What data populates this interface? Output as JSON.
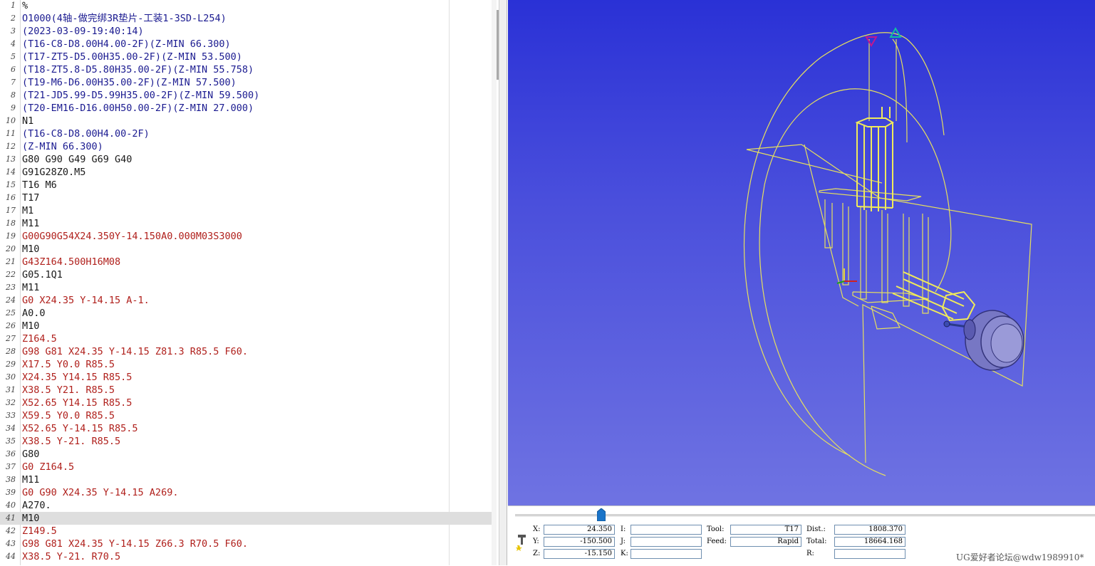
{
  "editor": {
    "lines": [
      {
        "n": "1",
        "text": "%",
        "color": "black"
      },
      {
        "n": "2",
        "text": "O1000(4轴-做完绑3R垫片-工装1-3SD-L254)",
        "color": "blue"
      },
      {
        "n": "3",
        "text": "(2023-03-09-19:40:14)",
        "color": "blue"
      },
      {
        "n": "4",
        "text": "(T16-C8-D8.00H4.00-2F)(Z-MIN 66.300)",
        "color": "blue"
      },
      {
        "n": "5",
        "text": "(T17-ZT5-D5.00H35.00-2F)(Z-MIN 53.500)",
        "color": "blue"
      },
      {
        "n": "6",
        "text": "(T18-ZT5.8-D5.80H35.00-2F)(Z-MIN 55.758)",
        "color": "blue"
      },
      {
        "n": "7",
        "text": "(T19-M6-D6.00H35.00-2F)(Z-MIN 57.500)",
        "color": "blue"
      },
      {
        "n": "8",
        "text": "(T21-JD5.99-D5.99H35.00-2F)(Z-MIN 59.500)",
        "color": "blue"
      },
      {
        "n": "9",
        "text": "(T20-EM16-D16.00H50.00-2F)(Z-MIN 27.000)",
        "color": "blue"
      },
      {
        "n": "10",
        "text": "N1",
        "color": "black"
      },
      {
        "n": "11",
        "text": "(T16-C8-D8.00H4.00-2F)",
        "color": "blue"
      },
      {
        "n": "12",
        "text": "(Z-MIN 66.300)",
        "color": "blue"
      },
      {
        "n": "13",
        "text": "G80 G90 G49 G69 G40",
        "color": "black"
      },
      {
        "n": "14",
        "text": "G91G28Z0.M5",
        "color": "black"
      },
      {
        "n": "15",
        "text": "T16 M6",
        "color": "black"
      },
      {
        "n": "16",
        "text": "T17",
        "color": "black"
      },
      {
        "n": "17",
        "text": "M1",
        "color": "black"
      },
      {
        "n": "18",
        "text": "M11",
        "color": "black"
      },
      {
        "n": "19",
        "text": "G00G90G54X24.350Y-14.150A0.000M03S3000",
        "color": "red"
      },
      {
        "n": "20",
        "text": "M10",
        "color": "black"
      },
      {
        "n": "21",
        "text": "G43Z164.500H16M08",
        "color": "red"
      },
      {
        "n": "22",
        "text": "G05.1Q1",
        "color": "black"
      },
      {
        "n": "23",
        "text": "M11",
        "color": "black"
      },
      {
        "n": "24",
        "text": "G0 X24.35 Y-14.15 A-1.",
        "color": "red"
      },
      {
        "n": "25",
        "text": "A0.0",
        "color": "black"
      },
      {
        "n": "26",
        "text": "M10",
        "color": "black"
      },
      {
        "n": "27",
        "text": "Z164.5",
        "color": "red"
      },
      {
        "n": "28",
        "text": "G98 G81 X24.35 Y-14.15 Z81.3 R85.5 F60.",
        "color": "red"
      },
      {
        "n": "29",
        "text": "X17.5 Y0.0 R85.5",
        "color": "red"
      },
      {
        "n": "30",
        "text": "X24.35 Y14.15 R85.5",
        "color": "red"
      },
      {
        "n": "31",
        "text": "X38.5 Y21. R85.5",
        "color": "red"
      },
      {
        "n": "32",
        "text": "X52.65 Y14.15 R85.5",
        "color": "red"
      },
      {
        "n": "33",
        "text": "X59.5 Y0.0 R85.5",
        "color": "red"
      },
      {
        "n": "34",
        "text": "X52.65 Y-14.15 R85.5",
        "color": "red"
      },
      {
        "n": "35",
        "text": "X38.5 Y-21. R85.5",
        "color": "red"
      },
      {
        "n": "36",
        "text": "G80",
        "color": "black"
      },
      {
        "n": "37",
        "text": "G0 Z164.5",
        "color": "red"
      },
      {
        "n": "38",
        "text": "M11",
        "color": "black"
      },
      {
        "n": "39",
        "text": "G0 G90 X24.35 Y-14.15 A269.",
        "color": "red"
      },
      {
        "n": "40",
        "text": "A270.",
        "color": "black"
      },
      {
        "n": "41",
        "text": "M10",
        "color": "black",
        "current": true
      },
      {
        "n": "42",
        "text": "Z149.5",
        "color": "red"
      },
      {
        "n": "43",
        "text": "G98 G81 X24.35 Y-14.15 Z66.3 R70.5 F60.",
        "color": "red"
      },
      {
        "n": "44",
        "text": "X38.5 Y-21. R70.5",
        "color": "red"
      }
    ]
  },
  "simulation": {
    "progress": 0.16,
    "fields": {
      "x_label": "X:",
      "x_value": "24.350",
      "y_label": "Y:",
      "y_value": "-150.500",
      "z_label": "Z:",
      "z_value": "-15.150",
      "i_label": "I:",
      "i_value": "",
      "j_label": "J:",
      "j_value": "",
      "k_label": "K:",
      "k_value": "",
      "tool_label": "Tool:",
      "tool_value": "T17",
      "feed_label": "Feed:",
      "feed_value": "Rapid",
      "dist_label": "Dist.:",
      "dist_value": "1808.370",
      "total_label": "Total:",
      "total_value": "18664.168",
      "r_label": "R:",
      "r_value": ""
    }
  },
  "watermark": "UG爱好者论坛@wdw1989910*",
  "colors": {
    "code_black": "#1a1a1a",
    "code_blue": "#1a1a90",
    "code_red": "#b0201c",
    "viewport_top": "#2a31d6",
    "viewport_bottom": "#6f73e2",
    "toolpath": "#e8e060"
  }
}
